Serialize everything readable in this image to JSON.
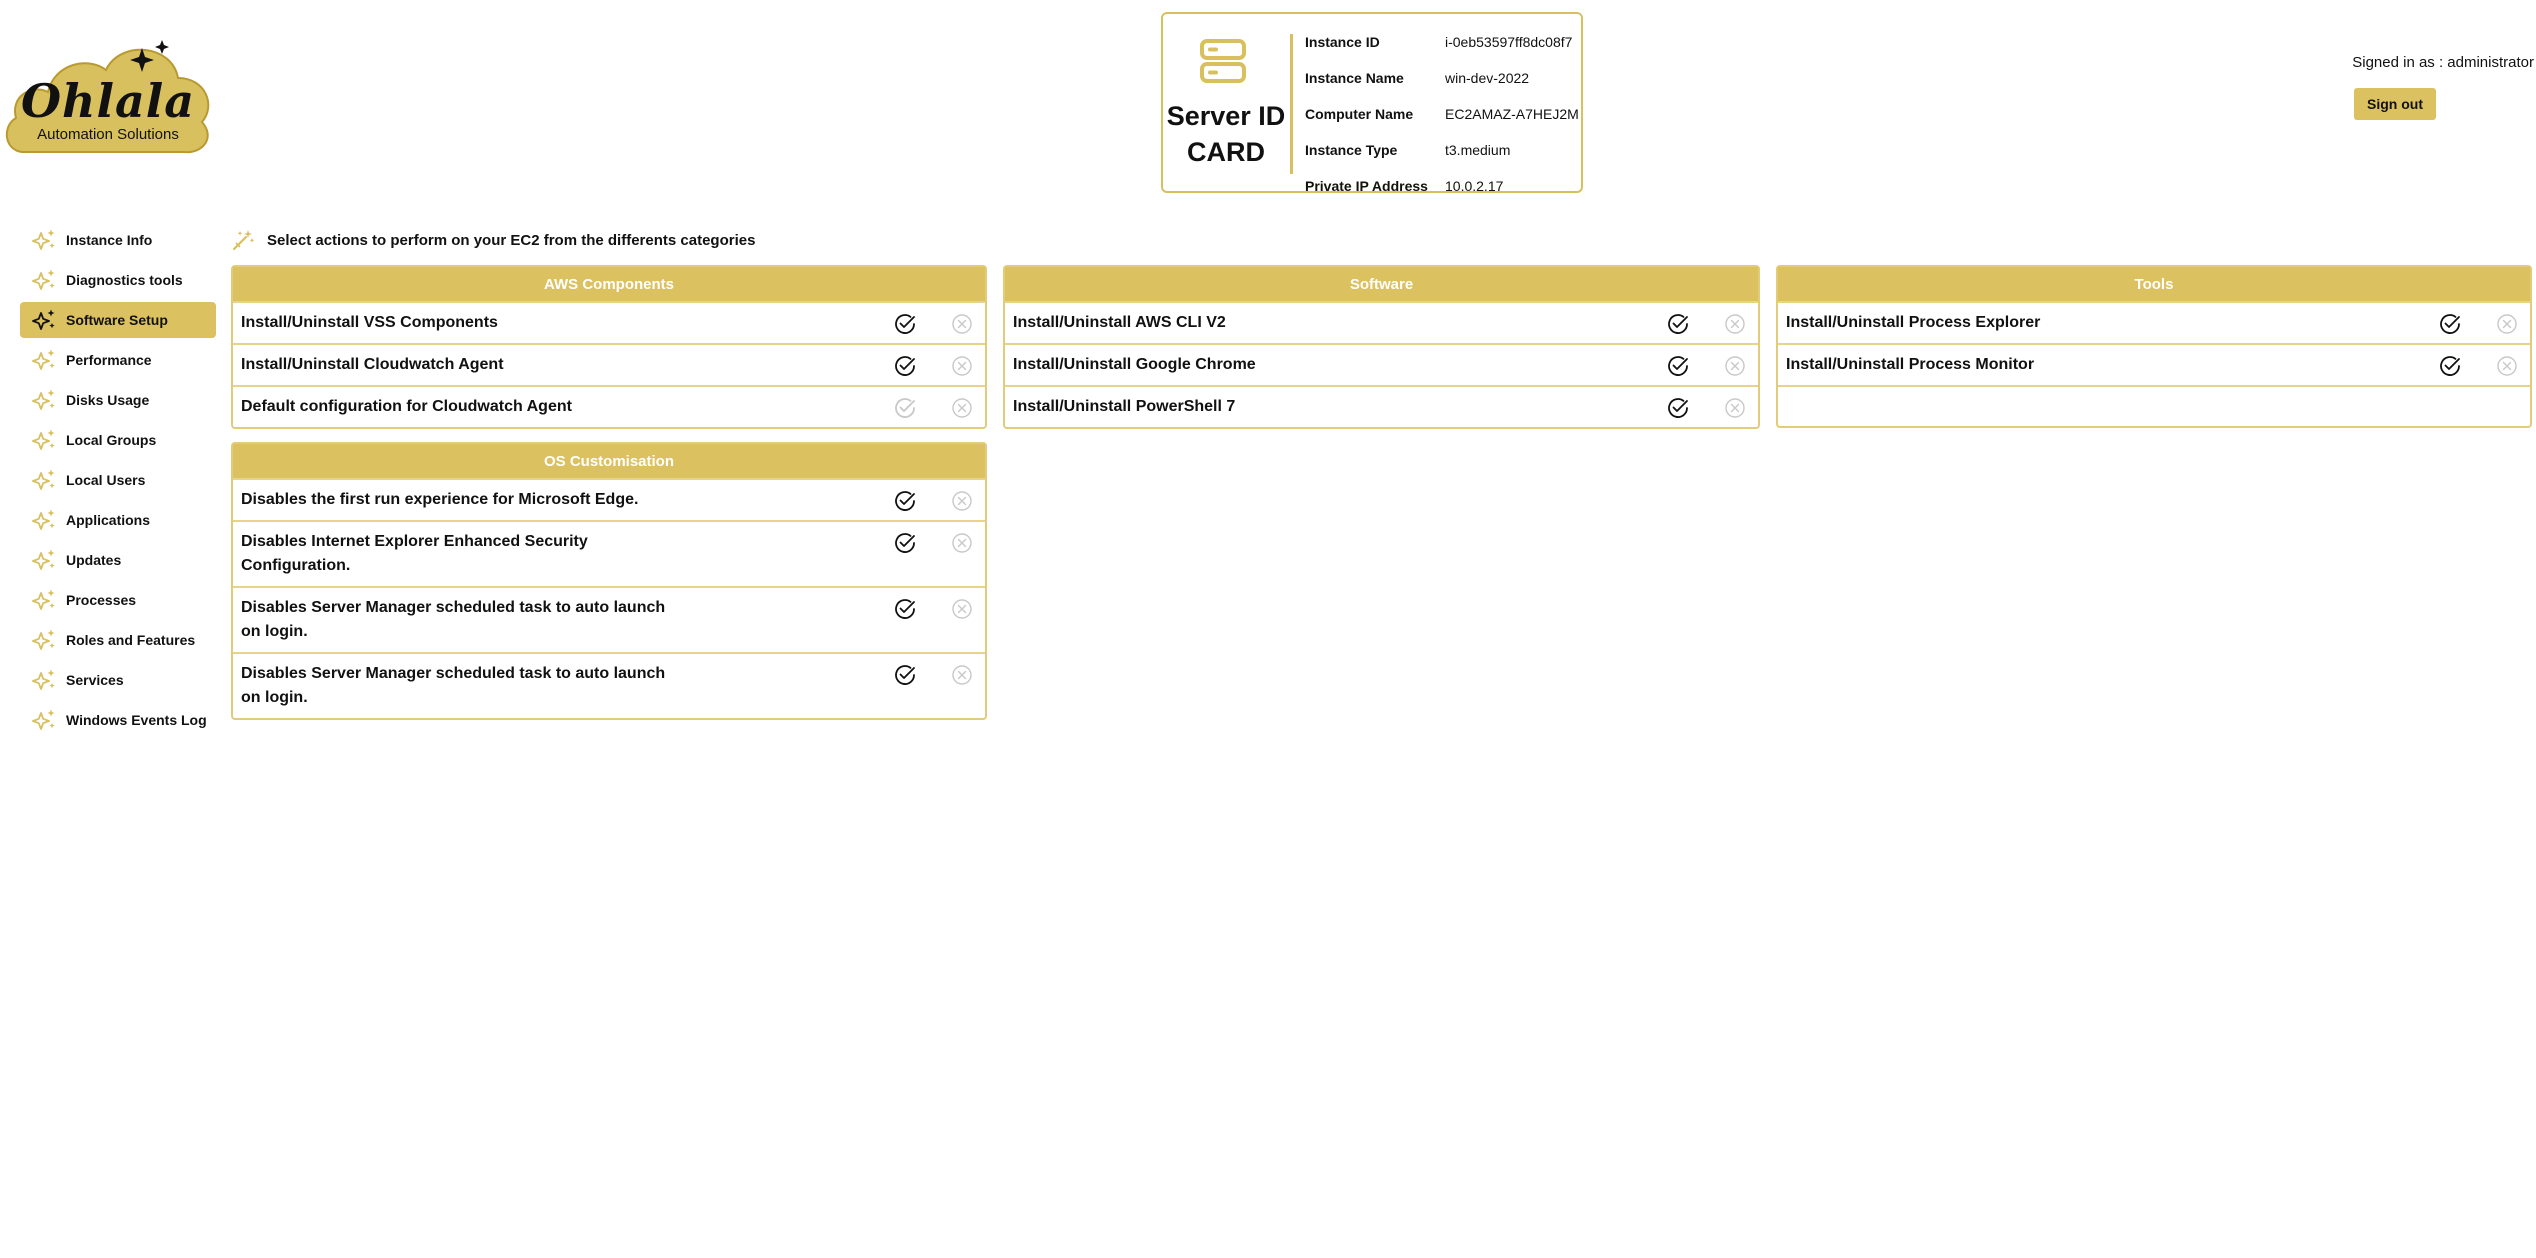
{
  "logo": {
    "word": "Ohlala",
    "subtitle": "Automation Solutions"
  },
  "id_card": {
    "title_line1": "Server ID",
    "title_line2": "CARD",
    "rows": [
      {
        "key": "Instance ID",
        "value": "i-0eb53597ff8dc08f7"
      },
      {
        "key": "Instance Name",
        "value": "win-dev-2022"
      },
      {
        "key": "Computer Name",
        "value": "EC2AMAZ-A7HEJ2M"
      },
      {
        "key": "Instance Type",
        "value": "t3.medium"
      },
      {
        "key": "Private IP Address",
        "value": "10.0.2.17"
      }
    ]
  },
  "header": {
    "signed_in": "Signed in as : administrator",
    "sign_out": "Sign out"
  },
  "sidebar": {
    "items": [
      {
        "label": "Instance Info"
      },
      {
        "label": "Diagnostics tools"
      },
      {
        "label": "Software Setup",
        "active": true
      },
      {
        "label": "Performance"
      },
      {
        "label": "Disks Usage"
      },
      {
        "label": "Local Groups"
      },
      {
        "label": "Local Users"
      },
      {
        "label": "Applications"
      },
      {
        "label": "Updates"
      },
      {
        "label": "Processes"
      },
      {
        "label": "Roles and Features"
      },
      {
        "label": "Services"
      },
      {
        "label": "Windows Events Log"
      }
    ]
  },
  "main": {
    "prompt": "Select actions to perform on your EC2 from the differents categories",
    "panels": {
      "aws": {
        "title": "AWS Components",
        "rows": [
          {
            "label": "Install/Uninstall VSS Components",
            "install_enabled": true
          },
          {
            "label": "Install/Uninstall Cloudwatch Agent",
            "install_enabled": true
          },
          {
            "label": "Default configuration for Cloudwatch Agent",
            "install_enabled": false
          }
        ]
      },
      "software": {
        "title": "Software",
        "rows": [
          {
            "label": "Install/Uninstall AWS CLI V2",
            "install_enabled": true
          },
          {
            "label": "Install/Uninstall Google Chrome",
            "install_enabled": true
          },
          {
            "label": "Install/Uninstall PowerShell 7",
            "install_enabled": true
          }
        ]
      },
      "tools": {
        "title": "Tools",
        "rows": [
          {
            "label": "Install/Uninstall Process Explorer",
            "install_enabled": true
          },
          {
            "label": "Install/Uninstall Process Monitor",
            "install_enabled": true
          }
        ]
      },
      "os": {
        "title": "OS Customisation",
        "rows": [
          {
            "label": "Disables the first run experience for Microsoft Edge.",
            "install_enabled": true
          },
          {
            "label": "Disables Internet Explorer Enhanced Security Configuration.",
            "install_enabled": true
          },
          {
            "label": "Disables Server Manager scheduled task to auto launch on login.",
            "install_enabled": true
          },
          {
            "label": "Disables Server Manager scheduled task to auto launch on login.",
            "install_enabled": true
          }
        ]
      }
    }
  },
  "colors": {
    "accent": "#dcc160",
    "border": "#e2cc79",
    "disabled": "#c8c8c8"
  },
  "icons": {
    "nav": "sparkles-icon",
    "ok": "check-circle-icon",
    "remove": "x-circle-icon",
    "prompt": "magic-wand-icon",
    "card": "server-icon"
  }
}
